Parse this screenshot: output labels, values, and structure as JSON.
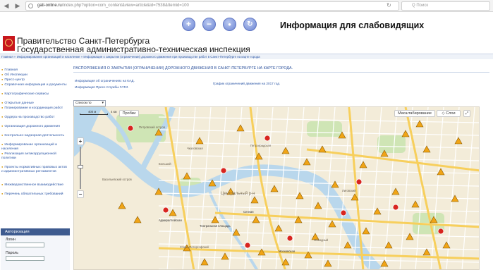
{
  "browser": {
    "url_prefix": "gati-online.ru",
    "url_rest": "/index.php?option=com_content&view=article&id=7538&Itemid=100",
    "search_placeholder": "Q Поиск"
  },
  "toolbar": {
    "increase_label": "+",
    "decrease_label": "−",
    "color_label": "●",
    "reset_label": "↻",
    "impaired_title": "Информация для слабовидящих"
  },
  "header": {
    "line1": "Правительство Санкт-Петербурга",
    "line2": "Государственная административно-техническая инспекция"
  },
  "breadcrumb": "Главная  »  Информирование организаций и население  »  Информация о закрытии (ограничении) дорожного движения при производстве работ в Санкт-Петербурге на карте города",
  "sidebar": {
    "items": [
      "Главная",
      "Об Инспекции",
      "Пресс-центр",
      "Справочная информация и документы",
      "Картографические сервисы",
      "Открытые данные",
      "Планирование и координация работ",
      "Ордера на производство работ",
      "Организация дорожного движения",
      "Контрольно-надзорная деятельность",
      "Информирование организаций и населения",
      "Реализация антикоррупционной политики",
      "Проекты нормативных правовых актов и административных регламентов",
      "Межведомственное взаимодействие",
      "Перечень обязательных требований"
    ],
    "auth": {
      "title": "Авторизация",
      "login_label": "Логин",
      "password_label": "Пароль"
    }
  },
  "content": {
    "heading": "РАСПОРЯЖЕНИЯ О ЗАКРЫТИИ (ОГРАНИЧЕНИИ) ДОРОЖНОГО ДВИЖЕНИЯ В САНКТ-ПЕТЕРБУРГЕ НА КАРТЕ ГОРОДА.",
    "link_kad": "Информация об ограничениях на КАД.",
    "link_press": "Информация Пресс-Службы ГАТИ.",
    "link_schedule": "График ограничений движения на 2017 год.",
    "period_select": "Список по «Четверг»"
  },
  "map": {
    "scale_label_left": "400 м",
    "scale_label_right": "4 км",
    "traffic_label": "Пробки",
    "measure_label": "Масштабирование",
    "layers_label": "Слои",
    "zoom_in": "+",
    "zoom_out": "−",
    "district_center": "Центральный р-н",
    "labels": [
      "Петровский остров",
      "Петроградская",
      "Васильевский остров",
      "Чкаловская",
      "Большой",
      "Адмиралтейская",
      "Театральная площадь",
      "Московская",
      "Сенная",
      "Лиговский",
      "Обводный",
      "Старо-Петергофский"
    ],
    "colors": {
      "land": "#f3ecd9",
      "water": "#b9d7ec",
      "park": "#cfe5b5",
      "road": "#f7cf5c",
      "minor_road": "#ffffff",
      "warning": "#f0a416",
      "stop": "#d8251f"
    }
  }
}
